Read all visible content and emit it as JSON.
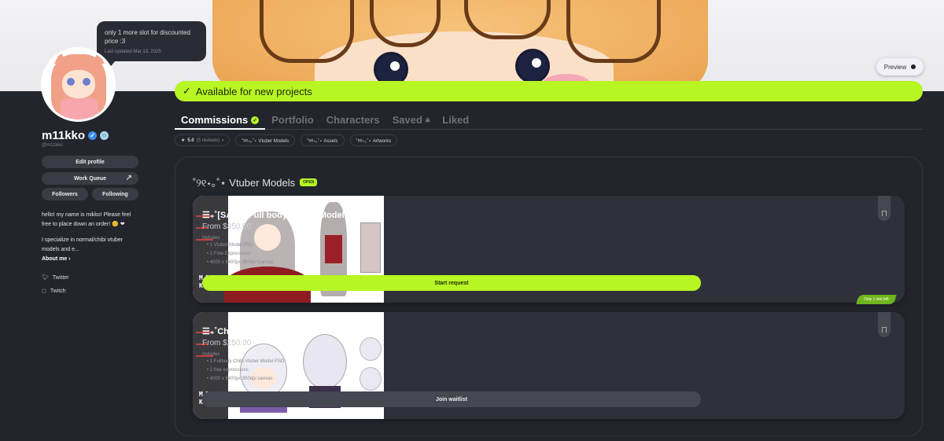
{
  "bubble": {
    "text": "only 1 more slot for discounted price :3",
    "updated": "Last updated Mar 13, 2025"
  },
  "preview": {
    "label": "Preview"
  },
  "profile": {
    "username": "m11kko",
    "handle": "@m11kko",
    "edit_label": "Edit profile",
    "work_queue_label": "Work Queue",
    "followers_label": "Followers",
    "following_label": "Following",
    "bio_line1": "hello! my name is mikko! Please feel free to place down an order! 😊 ❤",
    "bio_line2": "I specialize in normal/chibi vtuber models and e...",
    "about_label": "About me ›",
    "socials": [
      {
        "label": "Twitter",
        "icon": "twitter-icon"
      },
      {
        "label": "Twitch",
        "icon": "twitch-icon"
      }
    ]
  },
  "availability": {
    "label": "Available for new projects"
  },
  "tabs": [
    {
      "label": "Commissions"
    },
    {
      "label": "Portfolio"
    },
    {
      "label": "Characters"
    },
    {
      "label": "Saved"
    },
    {
      "label": "Liked"
    }
  ],
  "chips": {
    "rating": "5.0",
    "reviews": "(5 reviews)",
    "items": [
      "˚୨୧⋆｡˚⋆ Vtuber Models",
      "˚୨୧⋆｡˚⋆ Assets",
      "˚୨୧⋆｡˚⋆ Artworks"
    ]
  },
  "section": {
    "title": "˚୨୧⋆｡˚⋆ Vtuber Models",
    "badge": "OPEN"
  },
  "cards": [
    {
      "title": "☰₊˚[SALE] Full body Vtuber Model ・₊✧",
      "price": "From $350.00",
      "includes_label": "Includes",
      "includes": [
        "1 Vtuber Model PSD",
        "2 Free Expressions",
        "4000 x 6400px 350dpi Canvas"
      ],
      "button": "Start request",
      "badge": "Only 1 slot left",
      "logo": "M11\nKKO"
    },
    {
      "title": "☰₊˚Chibi Vtuber Model ・₊✧",
      "price": "From $250.00",
      "includes_label": "Includes",
      "includes": [
        "1 Fullbody Chibi Vtuber Model PSD",
        "2 free expressions",
        "4000 x 6400px 350dpi canvas"
      ],
      "button": "Join waitlist",
      "logo": "M11\nKKO"
    }
  ],
  "colors": {
    "accent": "#b7f523",
    "background": "#23252d",
    "card": "#2f313a"
  }
}
